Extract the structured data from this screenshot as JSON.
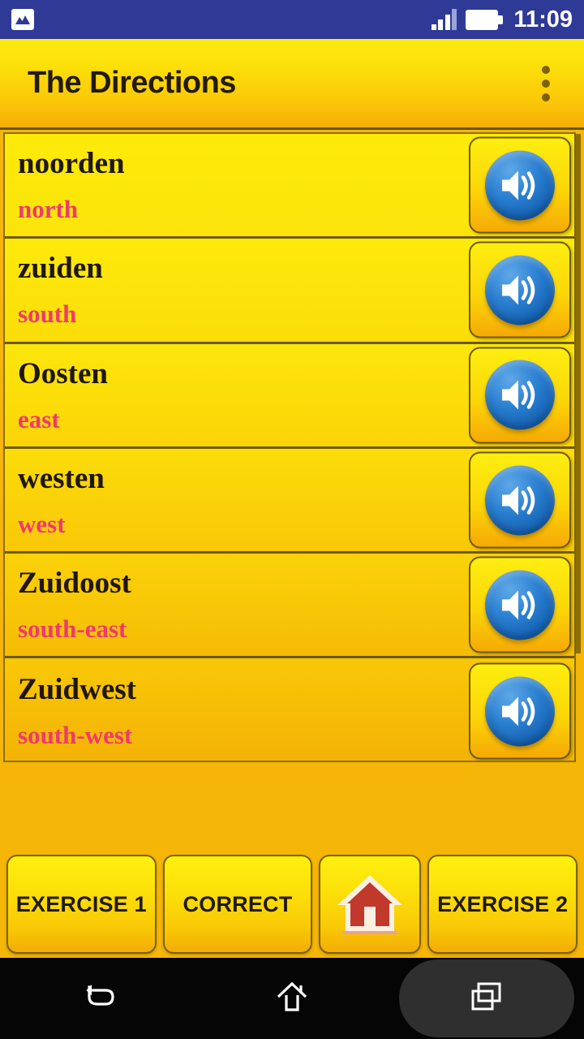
{
  "status_bar": {
    "notification_icon": "image-gallery-icon",
    "signal_icon": "signal-bars-icon",
    "battery_icon": "battery-full-icon",
    "time": "11:09",
    "background_color": "#2E3A96"
  },
  "app_bar": {
    "title": "The Directions",
    "overflow_icon": "overflow-menu-icon",
    "accent_gradient_start": "#FBEA12",
    "accent_gradient_end": "#F5AD06",
    "title_color": "#231A07"
  },
  "list": {
    "speaker_icon": "speaker-volume-icon",
    "native_color": "#20170A",
    "translation_color": "#EE3A6E",
    "items": [
      {
        "native": "noorden",
        "translation": "north"
      },
      {
        "native": "zuiden",
        "translation": "south"
      },
      {
        "native": "Oosten",
        "translation": "east"
      },
      {
        "native": "westen",
        "translation": "west"
      },
      {
        "native": "Zuidoost",
        "translation": "south-east"
      },
      {
        "native": "Zuidwest",
        "translation": "south-west"
      }
    ]
  },
  "button_bar": {
    "buttons": [
      {
        "label": "EXERCISE 1",
        "name": "exercise-1-button"
      },
      {
        "label": "CORRECT",
        "name": "correct-button"
      },
      {
        "label": "",
        "name": "home-button",
        "icon": "house-icon"
      },
      {
        "label": "EXERCISE 2",
        "name": "exercise-2-button"
      }
    ]
  },
  "nav_bar": {
    "back_icon": "back-arrow-icon",
    "home_icon": "home-outline-icon",
    "recents_icon": "recent-apps-icon",
    "background_color": "#050505"
  }
}
